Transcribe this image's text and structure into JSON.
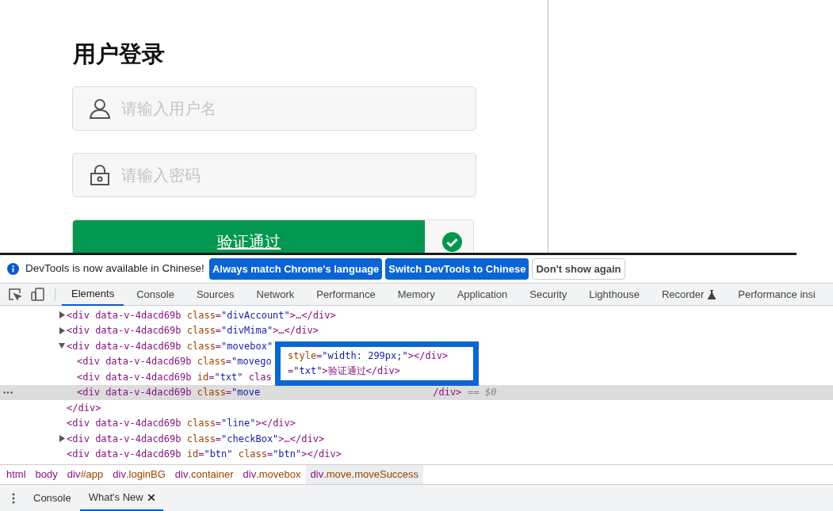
{
  "page": {
    "title": "用户登录",
    "username_field": {
      "placeholder": "请输入用户名"
    },
    "password_field": {
      "placeholder": "请输入密码"
    },
    "slider": {
      "label": "验证通过",
      "level": 0.88,
      "verified": true
    }
  },
  "devtools": {
    "infobar": {
      "message": "DevTools is now available in Chinese!",
      "buttons": [
        {
          "label": "Always match Chrome's language",
          "kind": "primary"
        },
        {
          "label": "Switch DevTools to Chinese",
          "kind": "primary"
        },
        {
          "label": "Don't show again",
          "kind": "secondary"
        }
      ]
    },
    "tabs": [
      {
        "label": "Elements",
        "selected": true,
        "experimental": false
      },
      {
        "label": "Console",
        "selected": false,
        "experimental": false
      },
      {
        "label": "Sources",
        "selected": false,
        "experimental": false
      },
      {
        "label": "Network",
        "selected": false,
        "experimental": false
      },
      {
        "label": "Performance",
        "selected": false,
        "experimental": false
      },
      {
        "label": "Memory",
        "selected": false,
        "experimental": false
      },
      {
        "label": "Application",
        "selected": false,
        "experimental": false
      },
      {
        "label": "Security",
        "selected": false,
        "experimental": false
      },
      {
        "label": "Lighthouse",
        "selected": false,
        "experimental": false
      },
      {
        "label": "Recorder",
        "selected": false,
        "experimental": true
      },
      {
        "label": "Performance insi",
        "selected": false,
        "experimental": false
      }
    ],
    "dom_tree": [
      {
        "text": "<div data-v-4dacd69b class=\"divAccount\">…</div>",
        "expanded": false,
        "selected": false
      },
      {
        "text": "<div data-v-4dacd69b class=\"divMima\">…</div>",
        "expanded": false,
        "selected": false
      },
      {
        "text": "<div data-v-4dacd69b class=\"movebox\"",
        "expanded": true,
        "selected": false,
        "closing": "</div>",
        "children": [
          {
            "text": "<div data-v-4dacd69b class=\"movego",
            "selected": false
          },
          {
            "text": "<div data-v-4dacd69b id=\"txt\" clas",
            "selected": false
          },
          {
            "text": "<div data-v-4dacd69b class=\"move",
            "tail": "/div>",
            "marker": "== $0",
            "selected": true
          }
        ]
      },
      {
        "text": "<div data-v-4dacd69b class=\"line\"></div>",
        "selected": false
      },
      {
        "text": "<div data-v-4dacd69b class=\"checkBox\">…</div>",
        "expanded": false,
        "selected": false
      },
      {
        "text": "<div data-v-4dacd69b id=\"btn\" class=\"btn\"></div>",
        "selected": false
      }
    ],
    "annotation": {
      "lines": [
        "style=\"width: 299px;\"></div>",
        "=\"txt\">验证通过</div>"
      ]
    },
    "breadcrumbs": [
      {
        "tag": "html",
        "selected": false
      },
      {
        "tag": "body",
        "selected": false
      },
      {
        "tag": "div",
        "rest": "#app",
        "selected": false
      },
      {
        "tag": "div",
        "rest": ".loginBG",
        "selected": false
      },
      {
        "tag": "div",
        "rest": ".container",
        "selected": false
      },
      {
        "tag": "div",
        "rest": ".movebox",
        "selected": false
      },
      {
        "tag": "div",
        "rest": ".move.moveSuccess",
        "selected": true
      }
    ],
    "drawer_tabs": [
      {
        "label": "Console",
        "selected": false,
        "closable": false
      },
      {
        "label": "What's New",
        "selected": true,
        "closable": true
      }
    ]
  }
}
